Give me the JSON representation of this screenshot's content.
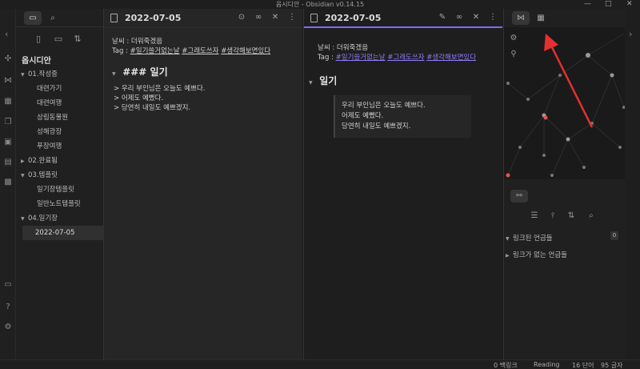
{
  "window": {
    "title": "옵시디안 - Obsidian v0.14.15",
    "minimize": "—",
    "maximize": "□",
    "close": "✕"
  },
  "ribbon": {
    "icons": [
      "graph-icon",
      "calendar-icon",
      "copy-icon",
      "terminal-icon",
      "drawer-icon",
      "puzzle-icon",
      "vault-icon",
      "help-icon",
      "settings-icon"
    ]
  },
  "sidebar": {
    "vault_name": "옵시디안",
    "items": [
      {
        "type": "folder",
        "label": "01.작성중",
        "expanded": true
      },
      {
        "type": "file",
        "label": "대련가기"
      },
      {
        "type": "file",
        "label": "대련여행"
      },
      {
        "type": "file",
        "label": "삼립동물원"
      },
      {
        "type": "file",
        "label": "성해광장"
      },
      {
        "type": "file",
        "label": "푸장여행"
      },
      {
        "type": "folder",
        "label": "02.완료됨",
        "expanded": false
      },
      {
        "type": "folder",
        "label": "03.템플릿",
        "expanded": true
      },
      {
        "type": "file",
        "label": "일기장템플릿"
      },
      {
        "type": "file",
        "label": "일반노트템플릿"
      },
      {
        "type": "folder",
        "label": "04.일기장",
        "expanded": true
      },
      {
        "type": "file",
        "label": "2022-07-05",
        "active": true
      }
    ]
  },
  "editor": {
    "title": "2022-07-05",
    "weather_line": "날씨 : 더워죽겠음",
    "tag_prefix": "Tag : ",
    "tags": [
      "#일기쓸거없는날",
      "#그래도쓰자",
      "#생각해보면있다"
    ],
    "tag_sep": " ",
    "heading_source": "### 일기",
    "quote_lines": [
      "> 우리 부인님은 오늘도 예쁘다.",
      "> 어제도 예뻤다.",
      "> 당연히 내일도 예쁘겠지."
    ]
  },
  "preview": {
    "title": "2022-07-05",
    "weather_line": "날씨 : 더워죽겠음",
    "tag_prefix": "Tag : ",
    "heading": "일기",
    "quote_lines": [
      "우리 부인님은 오늘도 예쁘다.",
      "어제도 예뻤다.",
      "당연히 내일도 예쁘겠지."
    ]
  },
  "backlinks": {
    "linked": "링크된 언급들",
    "linked_count": "0",
    "unlinked": "링크가 없는 언급들"
  },
  "status": {
    "backlinks": "0 백링크",
    "mode": "Reading",
    "words": "16 단어",
    "chars": "95 글자"
  },
  "colors": {
    "accent": "#7f6df2",
    "tag_link": "#8f7df5",
    "graph_node_red": "#e05555",
    "arrow_red": "#e53030"
  }
}
